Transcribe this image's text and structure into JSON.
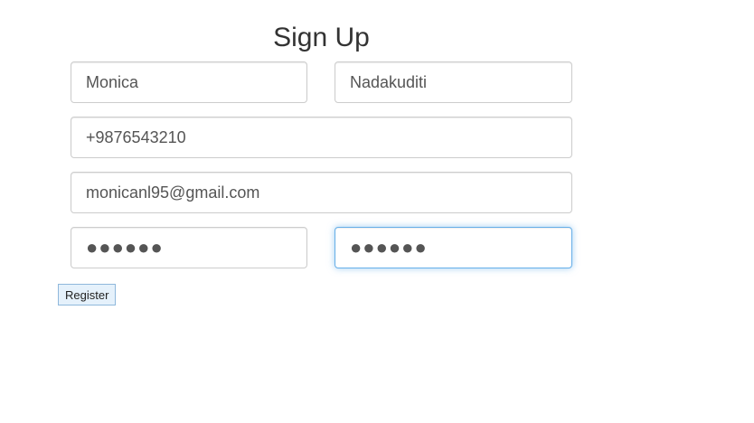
{
  "form": {
    "title": "Sign Up",
    "first_name": {
      "value": "Monica"
    },
    "last_name": {
      "value": "Nadakuditi"
    },
    "phone": {
      "value": "+9876543210"
    },
    "email": {
      "value": "monicanl95@gmail.com"
    },
    "password": {
      "value": "●●●●●●"
    },
    "confirm_password": {
      "value": "●●●●●●"
    },
    "register_label": "Register"
  },
  "colors": {
    "focus_border": "#66afe9",
    "button_bg": "#e5f1fb"
  }
}
